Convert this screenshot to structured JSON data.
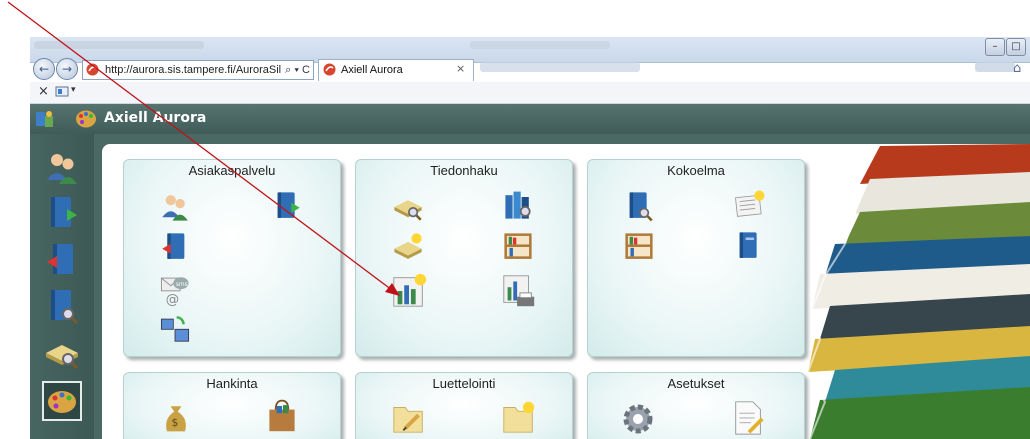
{
  "browser": {
    "url": "http://aurora.sis.tampere.fi/AuroraSilver.W",
    "address_controls": "⌕ ▾ C",
    "tab_title": "Axiell Aurora",
    "tab_close": "×",
    "back": "←",
    "forward": "→",
    "min": "–",
    "restore": "□",
    "home": "⌂",
    "cmd_close": "×",
    "cmd_drop": "▾"
  },
  "app": {
    "title": "Axiell Aurora",
    "accent": "#4a6864"
  },
  "tiles": [
    {
      "title": "Asiakaspalvelu",
      "icons": [
        "customers-icon",
        "checkout-icon",
        "checkin-icon",
        "sms-email-icon",
        "network-icon"
      ]
    },
    {
      "title": "Tiedonhaku",
      "icons": [
        "search-records-icon",
        "catalog-books-icon",
        "search-new-icon",
        "shelf-icon",
        "statistics-icon",
        "report-print-icon"
      ]
    },
    {
      "title": "Kokoelma",
      "icons": [
        "book-search-icon",
        "newspaper-new-icon",
        "shelf-icon",
        "book-icon"
      ]
    },
    {
      "title": "Hankinta",
      "icons": [
        "money-bag-icon",
        "shopping-bag-icon"
      ]
    },
    {
      "title": "Luettelointi",
      "icons": [
        "folder-edit-icon",
        "folder-new-icon"
      ]
    },
    {
      "title": "Asetukset",
      "icons": [
        "gear-icon",
        "document-edit-icon"
      ]
    }
  ],
  "sidebar": {
    "items": [
      "customers-icon",
      "checkout-icon",
      "checkin-icon",
      "book-search-icon",
      "search-records-icon",
      "palette-icon"
    ],
    "active_index": 5
  }
}
